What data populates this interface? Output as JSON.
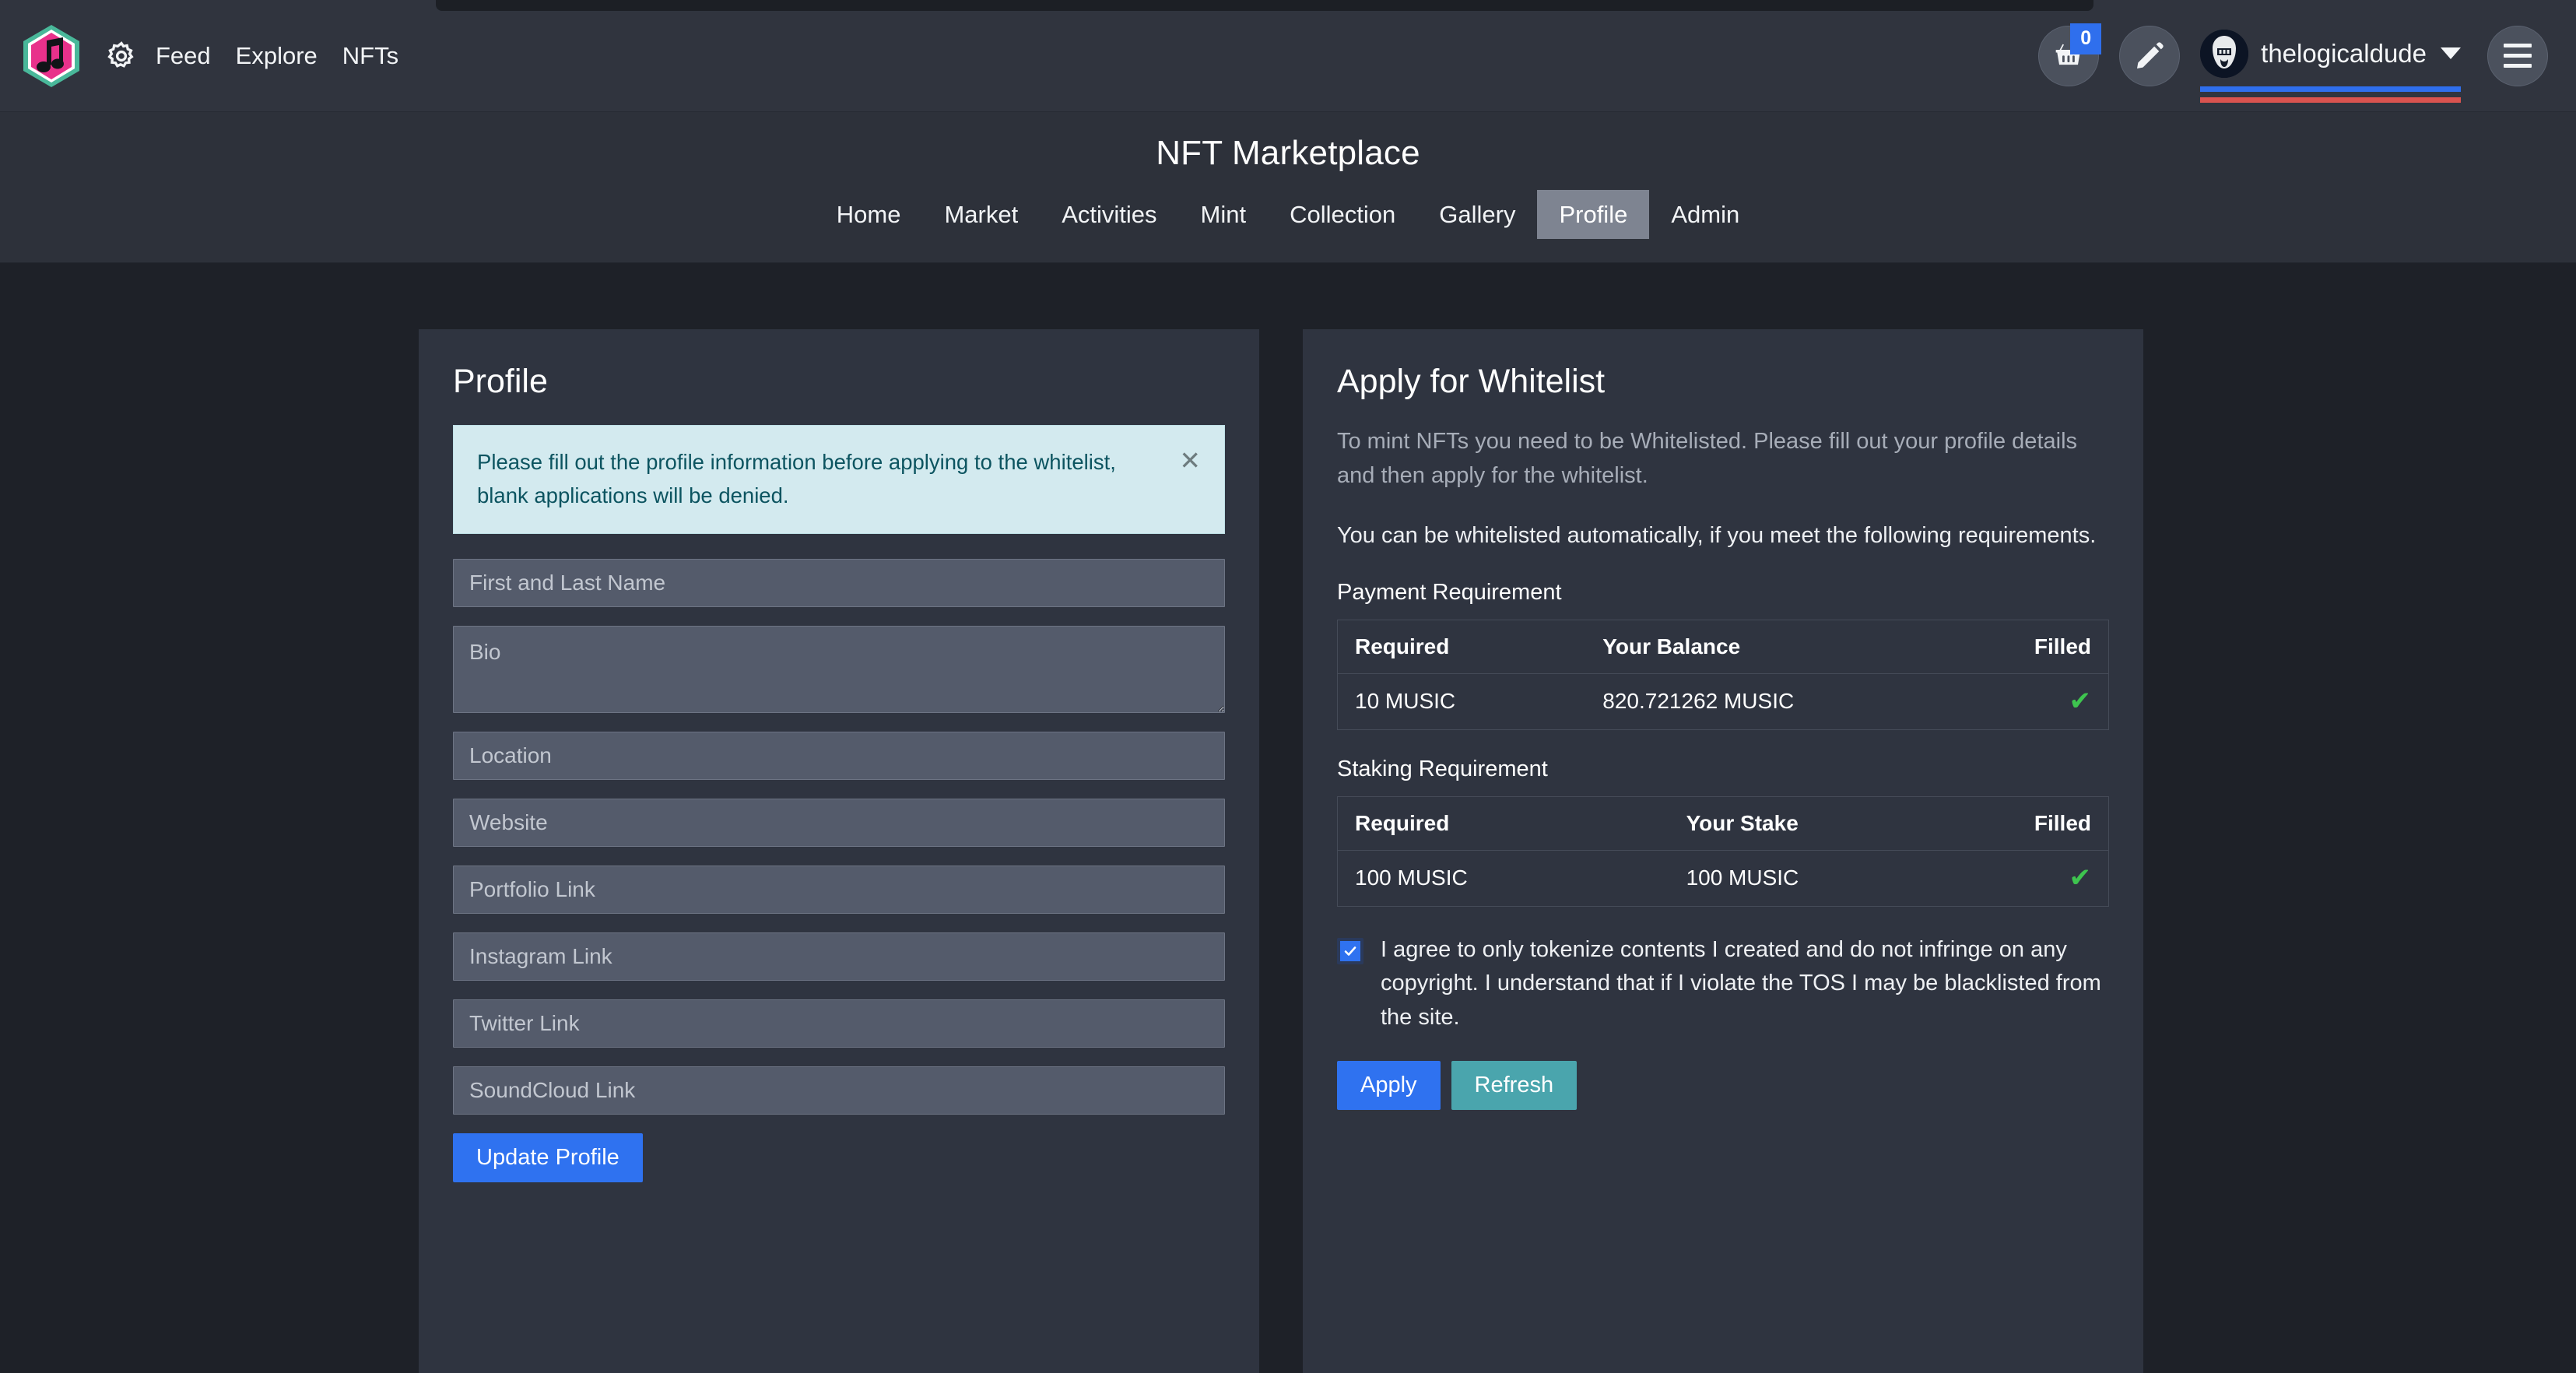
{
  "topbar": {
    "logo_icon": "music-note-hexagon-logo",
    "gear_icon": "gear-icon",
    "nav": [
      {
        "label": "Feed"
      },
      {
        "label": "Explore"
      },
      {
        "label": "NFTs"
      }
    ],
    "cart": {
      "icon": "basket-icon",
      "badge": "0"
    },
    "edit": {
      "icon": "pencil-icon"
    },
    "user": {
      "avatar_icon": "user-avatar",
      "name": "thelogicaldude",
      "caret_icon": "chevron-down-icon"
    },
    "menu": {
      "icon": "hamburger-menu-icon"
    },
    "colors": {
      "accent_blue": "#2f6fed",
      "accent_red": "#d9534f",
      "logo_pink": "#e8318b",
      "logo_teal": "#49b89a"
    }
  },
  "subheader": {
    "title": "NFT Marketplace",
    "tabs": [
      {
        "label": "Home",
        "active": false
      },
      {
        "label": "Market",
        "active": false
      },
      {
        "label": "Activities",
        "active": false
      },
      {
        "label": "Mint",
        "active": false
      },
      {
        "label": "Collection",
        "active": false
      },
      {
        "label": "Gallery",
        "active": false
      },
      {
        "label": "Profile",
        "active": true
      },
      {
        "label": "Admin",
        "active": false
      }
    ]
  },
  "profile_card": {
    "title": "Profile",
    "alert": {
      "text": "Please fill out the profile information before applying to the whitelist, blank applications will be denied.",
      "close_icon": "close-icon"
    },
    "fields": {
      "name_placeholder": "First and Last Name",
      "bio_placeholder": "Bio",
      "location_placeholder": "Location",
      "website_placeholder": "Website",
      "portfolio_placeholder": "Portfolio Link",
      "instagram_placeholder": "Instagram Link",
      "twitter_placeholder": "Twitter Link",
      "soundcloud_placeholder": "SoundCloud Link",
      "name_value": "",
      "bio_value": "",
      "location_value": "",
      "website_value": "",
      "portfolio_value": "",
      "instagram_value": "",
      "twitter_value": "",
      "soundcloud_value": ""
    },
    "update_button": "Update Profile"
  },
  "whitelist_card": {
    "title": "Apply for Whitelist",
    "intro": "To mint NFTs you need to be Whitelisted. Please fill out your profile details and then apply for the whitelist.",
    "requirements_intro": "You can be whitelisted automatically, if you meet the following requirements.",
    "payment": {
      "label": "Payment Requirement",
      "headers": [
        "Required",
        "Your Balance",
        "Filled"
      ],
      "row": {
        "required": "10 MUSIC",
        "balance": "820.721262 MUSIC",
        "filled_icon": "check-icon",
        "filled": true
      }
    },
    "staking": {
      "label": "Staking Requirement",
      "headers": [
        "Required",
        "Your Stake",
        "Filled"
      ],
      "row": {
        "required": "100 MUSIC",
        "stake": "100 MUSIC",
        "filled_icon": "check-icon",
        "filled": true
      }
    },
    "agreement": {
      "checked": true,
      "text": "I agree to only tokenize contents I created and do not infringe on any copyright. I understand that if I violate the TOS I may be blacklisted from the site."
    },
    "apply_button": "Apply",
    "refresh_button": "Refresh",
    "colors": {
      "apply": "#2f72f0",
      "refresh": "#4aa5ad",
      "check": "#3ec44f"
    }
  }
}
